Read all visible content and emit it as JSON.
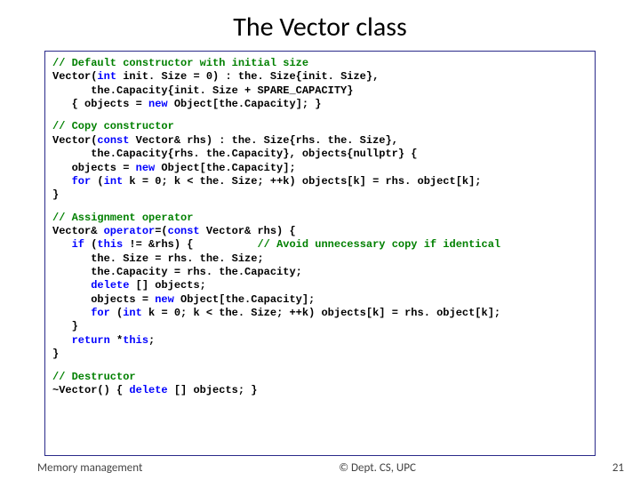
{
  "title": "The Vector class",
  "code": {
    "b1": {
      "c1": "// Default constructor with initial size",
      "l2_a": "Vector(",
      "l2_b": "int",
      "l2_c": " init. Size = 0) : the. Size{init. Size},",
      "l3": "      the.Capacity{init. Size + SPARE_CAPACITY}",
      "l4_a": "   { objects = ",
      "l4_b": "new",
      "l4_c": " Object[the.Capacity]; }"
    },
    "b2": {
      "c1": "// Copy constructor",
      "l2_a": "Vector(",
      "l2_b": "const",
      "l2_c": " Vector& rhs) : the. Size{rhs. the. Size},",
      "l3": "      the.Capacity{rhs. the.Capacity}, objects{nullptr} {",
      "l4_a": "   objects = ",
      "l4_b": "new",
      "l4_c": " Object[the.Capacity];",
      "l5_a": "   ",
      "l5_b": "for",
      "l5_c": " (",
      "l5_d": "int",
      "l5_e": " k = 0; k < the. Size; ++k) objects[k] = rhs. object[k];",
      "l6": "}"
    },
    "b3": {
      "c1": "// Assignment operator",
      "l2_a": "Vector& ",
      "l2_b": "operator",
      "l2_c": "=(",
      "l2_d": "const",
      "l2_e": " Vector& rhs) {",
      "l3_a": "   ",
      "l3_b": "if",
      "l3_c": " (",
      "l3_d": "this",
      "l3_e": " != &rhs) {          ",
      "l3_f": "// Avoid unnecessary copy if identical",
      "l4": "      the. Size = rhs. the. Size;",
      "l5": "      the.Capacity = rhs. the.Capacity;",
      "l6_a": "      ",
      "l6_b": "delete",
      "l6_c": " [] objects;",
      "l7_a": "      objects = ",
      "l7_b": "new",
      "l7_c": " Object[the.Capacity];",
      "l8_a": "      ",
      "l8_b": "for",
      "l8_c": " (",
      "l8_d": "int",
      "l8_e": " k = 0; k < the. Size; ++k) objects[k] = rhs. object[k];",
      "l9": "   }",
      "l10_a": "   ",
      "l10_b": "return",
      "l10_c": " *",
      "l10_d": "this",
      "l10_e": ";",
      "l11": "}"
    },
    "b4": {
      "c1": "// Destructor",
      "l2_a": "~Vector() { ",
      "l2_b": "delete",
      "l2_c": " [] objects; }"
    }
  },
  "footer": {
    "left": "Memory management",
    "center": "© Dept. CS, UPC",
    "page": "21"
  }
}
